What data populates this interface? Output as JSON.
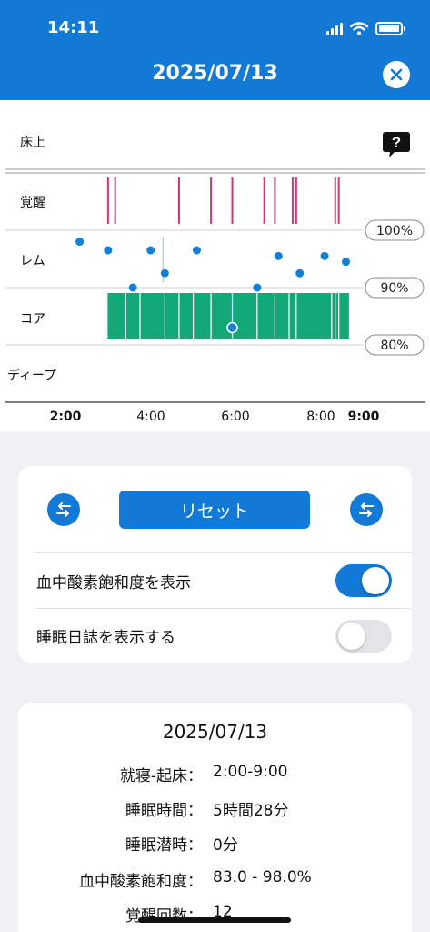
{
  "status_bar": {
    "time": "14:11"
  },
  "header": {
    "title": "2025/07/13",
    "close_icon": "close-icon"
  },
  "colors": {
    "accent": "#1379d6",
    "awake": "#d8336b",
    "core": "#13a878",
    "spo2": "#1380d8",
    "rem_line": "#a5d6a7"
  },
  "chart": {
    "stages": [
      "床上",
      "覚醒",
      "レム",
      "コア",
      "ディープ"
    ],
    "x_ticks": [
      {
        "label": "2:00",
        "bold": true
      },
      {
        "label": "4:00",
        "bold": false
      },
      {
        "label": "6:00",
        "bold": false
      },
      {
        "label": "8:00",
        "bold": false
      },
      {
        "label": "9:00",
        "bold": true
      }
    ],
    "spo2_ticks": [
      "100%",
      "90%",
      "80%"
    ]
  },
  "chart_data": {
    "type": "scatter",
    "title": "",
    "xlabel": "",
    "ylabel": "",
    "x_range": [
      "2:00",
      "9:00"
    ],
    "y_categories": [
      "床上",
      "覚醒",
      "レム",
      "コア",
      "ディープ"
    ],
    "awake_events": [
      "3:00",
      "3:10",
      "4:40",
      "5:25",
      "5:55",
      "6:40",
      "6:55",
      "7:20",
      "7:25",
      "8:20",
      "8:25"
    ],
    "core_periods": [
      {
        "start": "3:00",
        "end": "8:40"
      }
    ],
    "rem_marker": [
      "4:20"
    ],
    "spo2": {
      "y_ticks": [
        "100%",
        "90%",
        "80%"
      ],
      "ylim": [
        80,
        100
      ],
      "points": [
        {
          "time": "2:20",
          "value": 98.0
        },
        {
          "time": "3:00",
          "value": 96.5
        },
        {
          "time": "3:35",
          "value": 90.0
        },
        {
          "time": "4:00",
          "value": 96.5
        },
        {
          "time": "4:20",
          "value": 92.5
        },
        {
          "time": "5:05",
          "value": 96.5
        },
        {
          "time": "5:55",
          "value": 83.0
        },
        {
          "time": "6:30",
          "value": 90.0
        },
        {
          "time": "7:00",
          "value": 95.5
        },
        {
          "time": "7:30",
          "value": 92.5
        },
        {
          "time": "8:05",
          "value": 95.5
        },
        {
          "time": "8:35",
          "value": 94.5
        }
      ]
    }
  },
  "controls": {
    "prev_icon": "swap-arrows-icon",
    "next_icon": "swap-arrows-icon",
    "reset_label": "リセット",
    "spo2_toggle_label": "血中酸素飽和度を表示",
    "spo2_toggle_on": true,
    "diary_toggle_label": "睡眠日誌を表示する",
    "diary_toggle_on": false
  },
  "summary": {
    "date": "2025/07/13",
    "rows": [
      {
        "label": "就寝-起床：",
        "value": "2:00-9:00"
      },
      {
        "label": "睡眠時間：",
        "value": "5時間28分"
      },
      {
        "label": "睡眠潜時：",
        "value": "0分"
      },
      {
        "label": "血中酸素飽和度：",
        "value": "83.0 - 98.0%"
      },
      {
        "label": "覚醒回数：",
        "value": "12"
      }
    ]
  }
}
